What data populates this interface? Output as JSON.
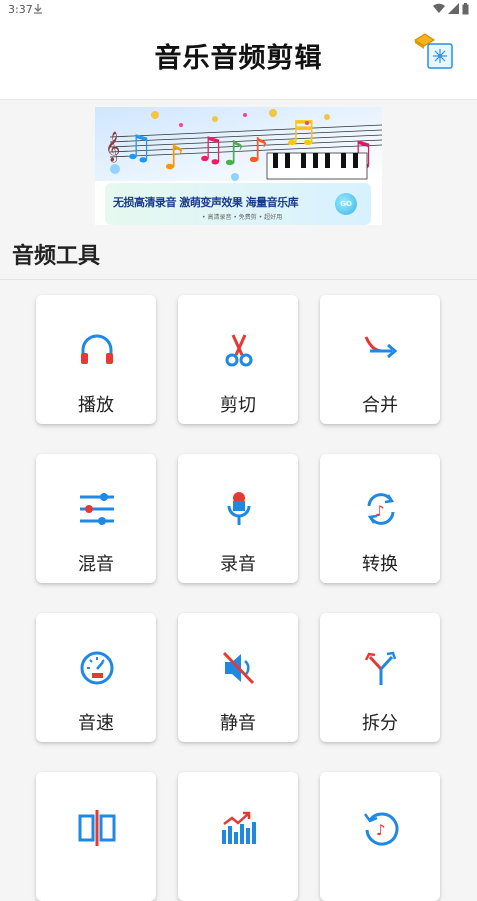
{
  "status_bar": {
    "time": "3:37",
    "download_icon": "download-arrow-icon"
  },
  "app_bar": {
    "title": "音乐音频剪辑",
    "menu_icon": "gift-box-icon"
  },
  "banner": {
    "headline": "无损高清录音 激萌变声效果 海量音乐库",
    "subline": "• 高清录音 • 免费剪 • 超好用",
    "go_label": "GO"
  },
  "section": {
    "title": "音频工具"
  },
  "tools": [
    {
      "label": "播放",
      "icon": "headphones-icon"
    },
    {
      "label": "剪切",
      "icon": "scissors-icon"
    },
    {
      "label": "合并",
      "icon": "merge-arrow-icon"
    },
    {
      "label": "混音",
      "icon": "mixer-sliders-icon"
    },
    {
      "label": "录音",
      "icon": "microphone-icon"
    },
    {
      "label": "转换",
      "icon": "convert-music-icon"
    },
    {
      "label": "音速",
      "icon": "speedometer-icon"
    },
    {
      "label": "静音",
      "icon": "mute-speaker-icon"
    },
    {
      "label": "拆分",
      "icon": "split-arrows-icon"
    },
    {
      "label": "",
      "icon": "split-columns-icon"
    },
    {
      "label": "",
      "icon": "equalizer-bars-icon"
    },
    {
      "label": "",
      "icon": "undo-music-icon"
    }
  ],
  "colors": {
    "accent_blue": "#1e88e5",
    "accent_red": "#e53935",
    "background": "#f5f5f5",
    "card": "#ffffff"
  }
}
